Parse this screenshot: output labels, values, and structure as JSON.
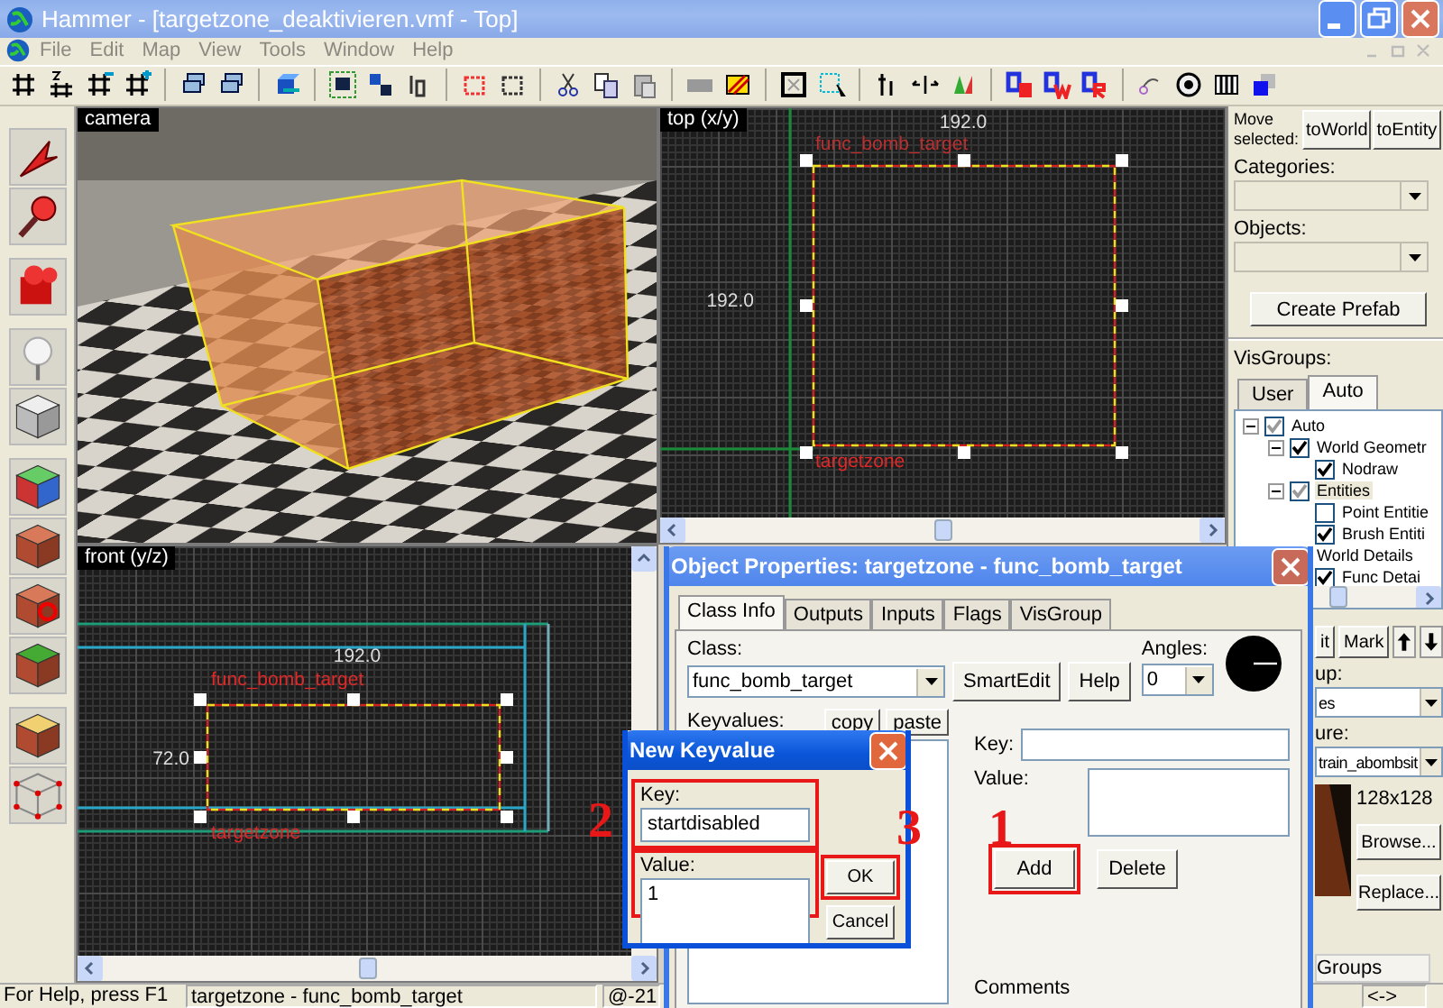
{
  "window": {
    "title": "Hammer - [targetzone_deaktivieren.vmf - Top]"
  },
  "menu": [
    {
      "label": "File",
      "disabled": true
    },
    {
      "label": "Edit",
      "disabled": true
    },
    {
      "label": "Map",
      "disabled": true
    },
    {
      "label": "View",
      "disabled": true
    },
    {
      "label": "Tools",
      "disabled": true
    },
    {
      "label": "Window",
      "disabled": true
    },
    {
      "label": "Help",
      "disabled": true
    }
  ],
  "viewports": [
    {
      "kind": "camera",
      "label": "camera"
    },
    {
      "kind": "top",
      "label": "top (x/y)",
      "width_label": "192.0",
      "height_label": "192.0",
      "entity_class": "func_bomb_target",
      "entity_name": "targetzone"
    },
    {
      "kind": "front",
      "label": "front (y/z)",
      "width_label": "192.0",
      "height_label": "72.0",
      "entity_class": "func_bomb_target",
      "entity_name": "targetzone"
    }
  ],
  "side_panel": {
    "move_label": "Move selected:",
    "move_buttons": [
      "toWorld",
      "toEntity"
    ],
    "dropdowns": [
      {
        "label": "Categories:",
        "disabled": true
      },
      {
        "label": "Objects:",
        "disabled": true
      }
    ],
    "create_button": "Create Prefab",
    "visgroups_label": "VisGroups:",
    "visgroup_tabs": [
      {
        "label": "User",
        "selected": false
      },
      {
        "label": "Auto",
        "selected": true
      }
    ],
    "visgroup_tree": [
      {
        "label": "Auto",
        "checked": true,
        "partial": true,
        "expanded": true,
        "selected": false,
        "children": [
          {
            "label": "World Geometr",
            "checked": true,
            "partial": false,
            "expanded": true,
            "selected": false,
            "children": [
              {
                "label": "Nodraw",
                "checked": true,
                "partial": false,
                "selected": false
              }
            ]
          },
          {
            "label": "Entities",
            "checked": true,
            "partial": true,
            "expanded": true,
            "selected": true,
            "children": [
              {
                "label": "Point Entitie",
                "checked": false,
                "selected": false
              },
              {
                "label": "Brush Entiti",
                "checked": true,
                "partial": false,
                "selected": false
              }
            ]
          },
          {
            "label": "World Details",
            "selected": false,
            "children": [
              {
                "label": "Func Detai",
                "checked": true,
                "partial": false,
                "selected": false
              }
            ]
          }
        ]
      }
    ],
    "edit_buttons": [
      "it",
      "Mark"
    ],
    "group_label": "up:",
    "group_value": "es",
    "texture_label": "ure:",
    "texture_value": "train_abombsit",
    "texture_size": "128x128",
    "texture_buttons": [
      "Browse...",
      "Replace..."
    ],
    "groups_field": "Groups"
  },
  "object_properties": {
    "title": "Object Properties: targetzone - func_bomb_target",
    "tabs": [
      {
        "label": "Class Info",
        "selected": true
      },
      {
        "label": "Outputs",
        "selected": false
      },
      {
        "label": "Inputs",
        "selected": false
      },
      {
        "label": "Flags",
        "selected": false
      },
      {
        "label": "VisGroup",
        "selected": false
      }
    ],
    "class_label": "Class:",
    "class_value": "func_bomb_target",
    "class_buttons": [
      "SmartEdit",
      "Help"
    ],
    "angles_label": "Angles:",
    "angles_value": "0",
    "keyvalues_label": "Keyvalues:",
    "keyvalue_buttons": [
      "copy",
      "paste"
    ],
    "key_label": "Key:",
    "value_label": "Value:",
    "action_buttons": [
      {
        "label": "Add",
        "highlighted": true
      },
      {
        "label": "Delete",
        "highlighted": false
      }
    ],
    "comments_label": "Comments"
  },
  "new_keyvalue": {
    "title": "New Keyvalue",
    "fields": [
      {
        "label": "Key:",
        "value": "startdisabled",
        "highlighted": true
      },
      {
        "label": "Value:",
        "value": "1",
        "highlighted": true
      }
    ],
    "buttons": [
      {
        "label": "OK",
        "highlighted": true
      },
      {
        "label": "Cancel",
        "highlighted": false
      }
    ]
  },
  "annotations": [
    {
      "text": "2"
    },
    {
      "text": "3"
    },
    {
      "text": "1"
    }
  ],
  "status_bar": [
    "For Help, press F1",
    "targetzone - func_bomb_target",
    "@-21",
    "<->"
  ]
}
